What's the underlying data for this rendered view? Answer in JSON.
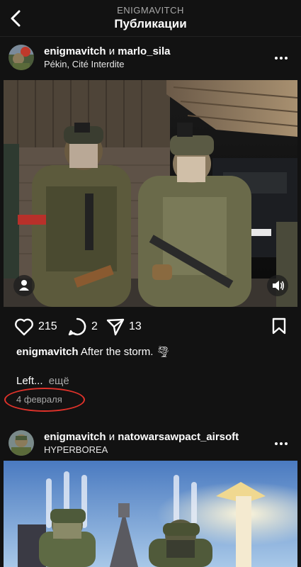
{
  "header": {
    "username": "ENIGMAVITCH",
    "title": "Публикации",
    "back_icon": "chevron-left-icon"
  },
  "posts": [
    {
      "author": "enigmavitch",
      "connector": "и",
      "collaborator": "marlo_sila",
      "location": "Pékin, Cité Interdite",
      "likes": "215",
      "comments": "2",
      "shares": "13",
      "caption_text": "After the storm.",
      "caption_emoji": "🌪",
      "caption_more_text": "Left...",
      "more_label": "ещё",
      "date": "4 февраля"
    },
    {
      "author": "enigmavitch",
      "connector": "и",
      "collaborator": "natowarsawpact_airsoft",
      "location": "HYPERBOREA"
    }
  ],
  "colors": {
    "background": "#121212",
    "secondary_text": "#a8a8a8",
    "annotation_circle": "#e0322a"
  }
}
